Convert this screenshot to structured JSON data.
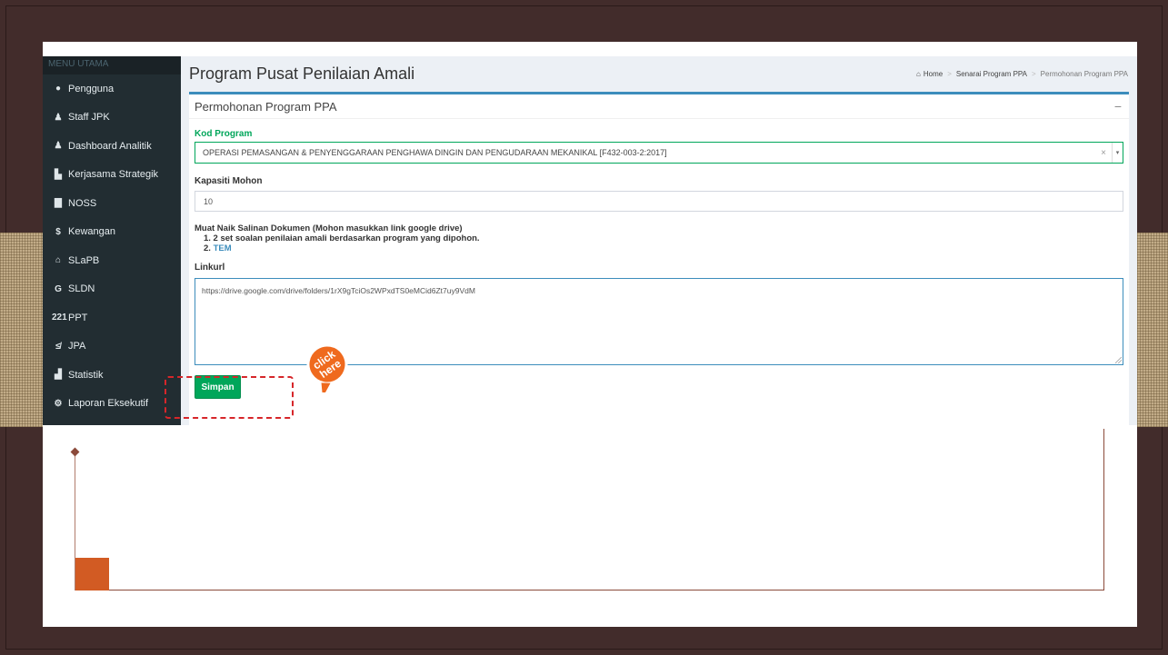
{
  "sidebar": {
    "header": "MENU UTAMA",
    "items": [
      {
        "label": "Pengguna",
        "icon": "●"
      },
      {
        "label": "Staff JPK",
        "icon": "♟"
      },
      {
        "label": "Dashboard Analitik",
        "icon": "♟"
      },
      {
        "label": "Kerjasama Strategik",
        "icon": "▙"
      },
      {
        "label": "NOSS",
        "icon": "▇"
      },
      {
        "label": "Kewangan",
        "icon": "$"
      },
      {
        "label": "SLaPB",
        "icon": "⌂"
      },
      {
        "label": "SLDN",
        "icon": "G"
      },
      {
        "label": "PPT",
        "icon": "221"
      },
      {
        "label": "JPA",
        "icon": "≰"
      },
      {
        "label": "Statistik",
        "icon": "▟"
      },
      {
        "label": "Laporan Eksekutif",
        "icon": "⚙"
      }
    ]
  },
  "header": {
    "title": "Program Pusat Penilaian Amali",
    "breadcrumb": {
      "home_icon": "⌂",
      "home": "Home",
      "sep": ">",
      "level2": "Senarai Program PPA",
      "current": "Permohonan Program PPA"
    }
  },
  "box": {
    "title": "Permohonan Program PPA",
    "collapse": "−"
  },
  "form": {
    "kod_program_label": "Kod Program",
    "kod_program_value": "OPERASI PEMASANGAN & PENYENGGARAAN PENGHAWA DINGIN DAN PENGUDARAAN MEKANIKAL [F432-003-2:2017]",
    "clear_symbol": "×",
    "arrow_symbol": "▾",
    "kapasiti_label": "Kapasiti Mohon",
    "kapasiti_value": "10",
    "upload_title": "Muat Naik Salinan Dokumen (Mohon masukkan link google drive)",
    "upload_item1": "1. 2 set soalan penilaian amali berdasarkan program yang dipohon.",
    "upload_item2_num": "2.",
    "upload_item2_link": "TEM",
    "linkurl_label": "Linkurl",
    "linkurl_value": "https://drive.google.com/drive/folders/1rX9gTciOs2WPxdTS0eMCid6Zt7uy9VdM",
    "submit_label": "Simpan"
  },
  "badge": {
    "line1": "click",
    "line2": "here"
  },
  "colors": {
    "accent": "#3c8dbc",
    "success": "#00a65a",
    "sidebar": "#222d32",
    "highlight": "#d6262a",
    "badge": "#ef6a1e"
  }
}
